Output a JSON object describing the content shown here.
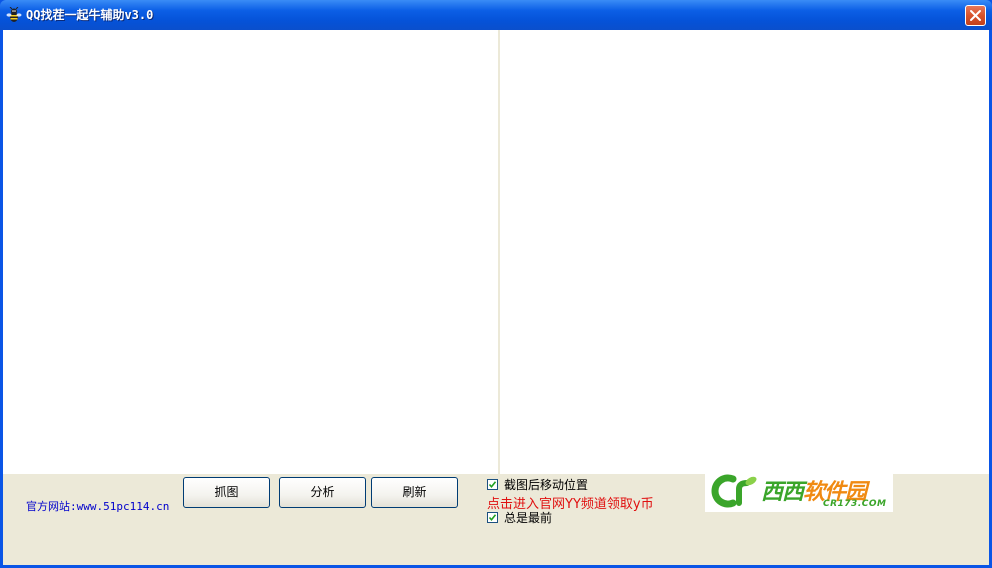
{
  "window": {
    "title": "QQ找茬一起牛辅助v3.0"
  },
  "icons": {
    "app": "bee-icon",
    "close": "close-icon",
    "check": "checkmark-icon"
  },
  "colors": {
    "titlebar": "#0552d8",
    "client": "#ece9d8",
    "website_text": "#0000cc",
    "promo_text": "#e01010",
    "logo_green": "#3aa52a",
    "logo_orange": "#f08a12"
  },
  "footer": {
    "website": "官方网站:www.51pc114.cn",
    "buttons": {
      "capture": "抓图",
      "analyze": "分析",
      "refresh": "刷新"
    },
    "options": [
      {
        "label": "截图后移动位置",
        "checked": true
      },
      {
        "label": "总是最前",
        "checked": true
      }
    ],
    "promo": "点击进入官网YY频道领取y币"
  },
  "logo": {
    "main_green": "西西",
    "main_orange": "软件园",
    "sub": "CR173.COM"
  }
}
